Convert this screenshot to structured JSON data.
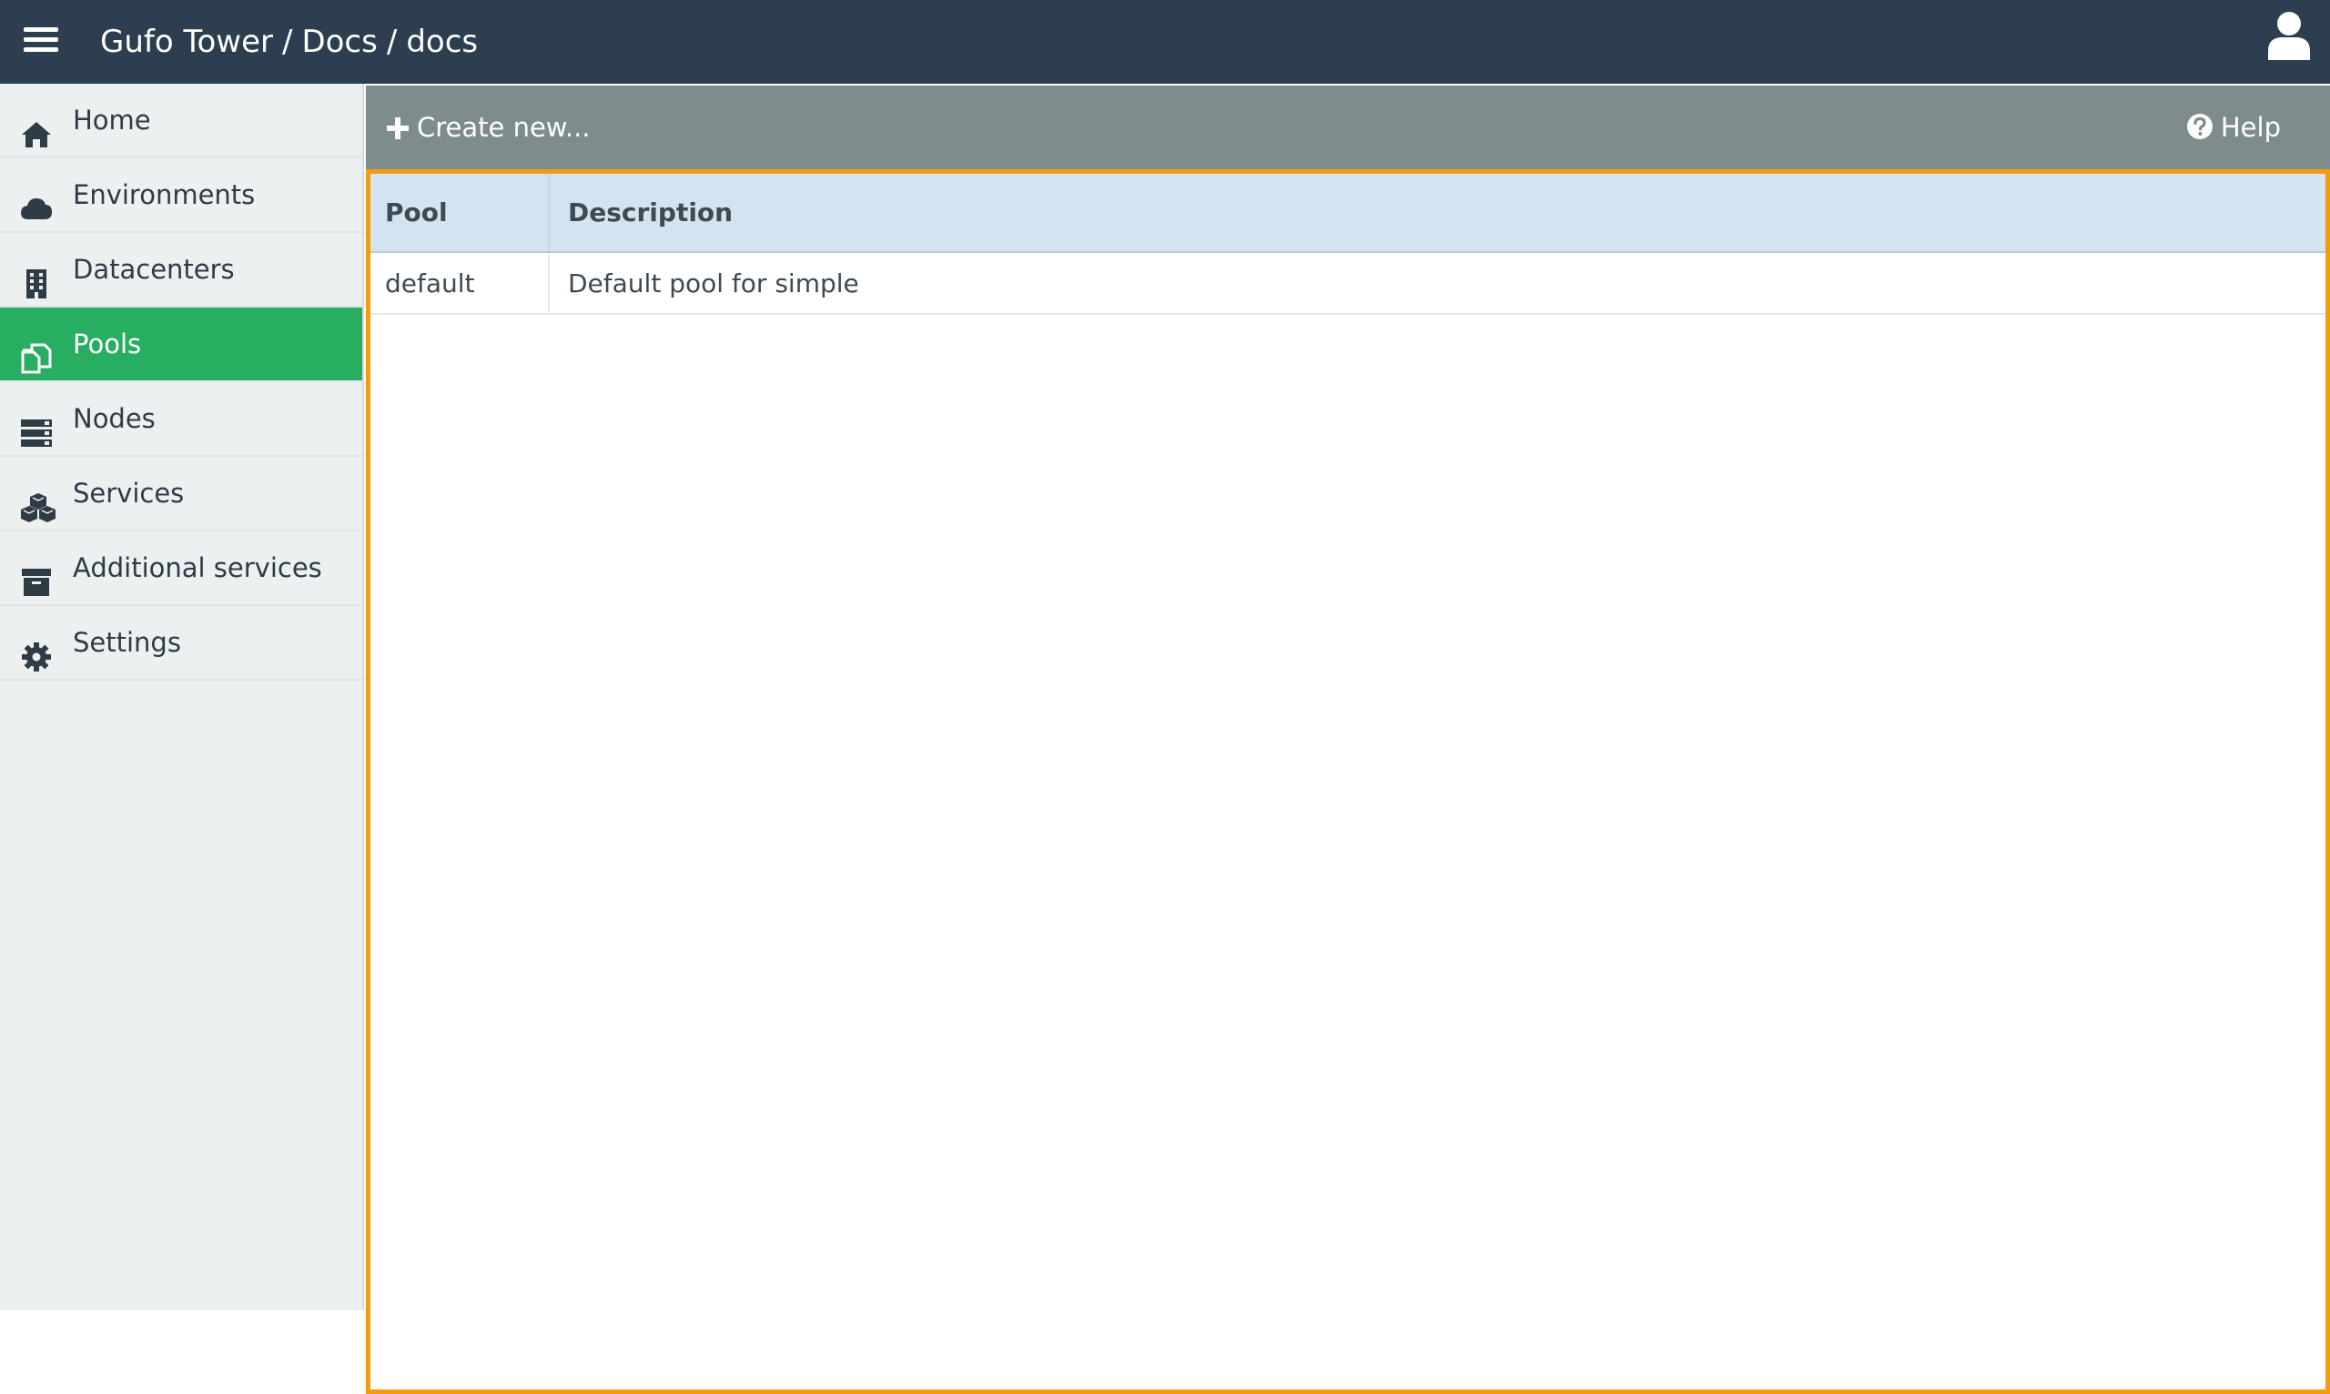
{
  "header": {
    "breadcrumb": [
      "Gufo Tower",
      "Docs",
      "docs"
    ],
    "separator": "/",
    "bg_color": "#2c3e50"
  },
  "sidebar": {
    "items": [
      {
        "label": "Home",
        "icon": "home-icon"
      },
      {
        "label": "Environments",
        "icon": "cloud-icon"
      },
      {
        "label": "Datacenters",
        "icon": "building-icon"
      },
      {
        "label": "Pools",
        "icon": "pools-icon",
        "active": true
      },
      {
        "label": "Nodes",
        "icon": "server-icon"
      },
      {
        "label": "Services",
        "icon": "cubes-icon"
      },
      {
        "label": "Additional services",
        "icon": "archive-icon"
      },
      {
        "label": "Settings",
        "icon": "gear-icon"
      }
    ],
    "active_color": "#27ae60"
  },
  "toolbar": {
    "create_label": "Create new...",
    "help_label": "Help"
  },
  "table": {
    "columns": [
      "Pool",
      "Description"
    ],
    "rows": [
      [
        "default",
        "Default pool for simple"
      ]
    ]
  },
  "colors": {
    "toolbar_bg": "#7f8c8d",
    "focus_border": "#f39c12",
    "header_row_bg": "#d3e3ef"
  }
}
